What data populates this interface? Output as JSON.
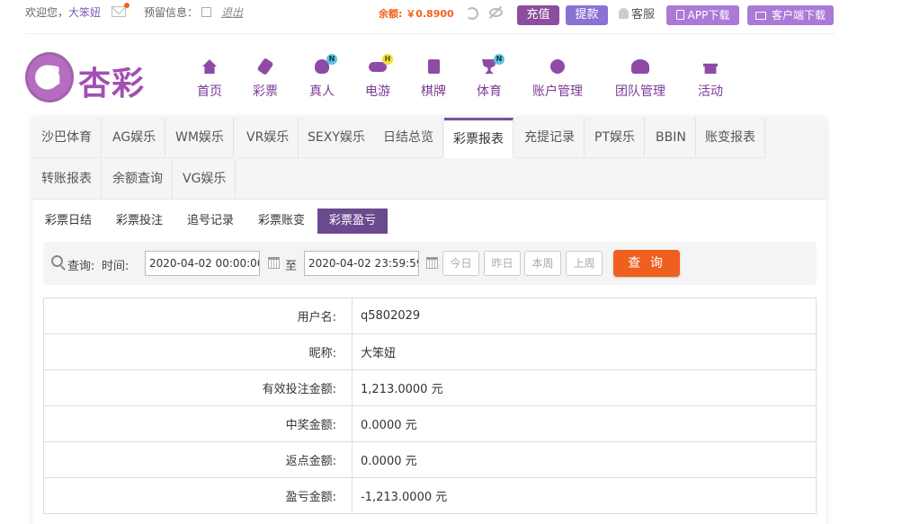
{
  "topbar": {
    "welcome_prefix": "欢迎您，",
    "nickname": "大笨妞",
    "message_label": "预留信息：",
    "logout": "退出",
    "balance": "余额: ￥0.8900",
    "deposit": "充值",
    "withdraw": "提款",
    "service": "客服",
    "app_download": "APP下载",
    "client_download": "客户端下载"
  },
  "logo": {
    "text": "杏彩"
  },
  "nav": [
    {
      "label": "首页",
      "icon": "home-icon"
    },
    {
      "label": "彩票",
      "icon": "lottery-icon"
    },
    {
      "label": "真人",
      "icon": "live-dealer-icon",
      "badge": "N"
    },
    {
      "label": "电游",
      "icon": "gamepad-icon",
      "badge": "H"
    },
    {
      "label": "棋牌",
      "icon": "cards-icon"
    },
    {
      "label": "体育",
      "icon": "trophy-icon",
      "badge": "N"
    },
    {
      "label": "账户管理",
      "icon": "account-icon"
    },
    {
      "label": "团队管理",
      "icon": "team-icon"
    },
    {
      "label": "活动",
      "icon": "gift-icon"
    }
  ],
  "tabs": [
    "沙巴体育",
    "AG娱乐",
    "WM娱乐",
    "VR娱乐",
    "SEXY娱乐",
    "日结总览",
    "彩票报表",
    "充提记录",
    "PT娱乐",
    "BBIN",
    "账变报表",
    "转账报表",
    "余额查询",
    "VG娱乐"
  ],
  "active_tab": "彩票报表",
  "subtabs": [
    "彩票日结",
    "彩票投注",
    "追号记录",
    "彩票账变",
    "彩票盈亏"
  ],
  "active_subtab": "彩票盈亏",
  "query": {
    "search_label": "查询:",
    "time_label": "时间:",
    "start": "2020-04-02 00:00:00",
    "to": "至",
    "end": "2020-04-02 23:59:59",
    "today": "今日",
    "yesterday": "昨日",
    "this_week": "本周",
    "last_week": "上周",
    "submit": "查 询"
  },
  "result": [
    {
      "label": "用户名:",
      "value": "q5802029"
    },
    {
      "label": "昵称:",
      "value": "大笨妞"
    },
    {
      "label": "有效投注金额:",
      "value": "1,213.0000 元"
    },
    {
      "label": "中奖金额:",
      "value": "0.0000 元"
    },
    {
      "label": "返点金额:",
      "value": "0.0000 元"
    },
    {
      "label": "盈亏金额:",
      "value": "-1,213.0000 元"
    }
  ],
  "colors": {
    "brand_purple": "#8c4e9c",
    "accent_orange": "#ef5f20",
    "active_subtab": "#6a4a8e"
  }
}
